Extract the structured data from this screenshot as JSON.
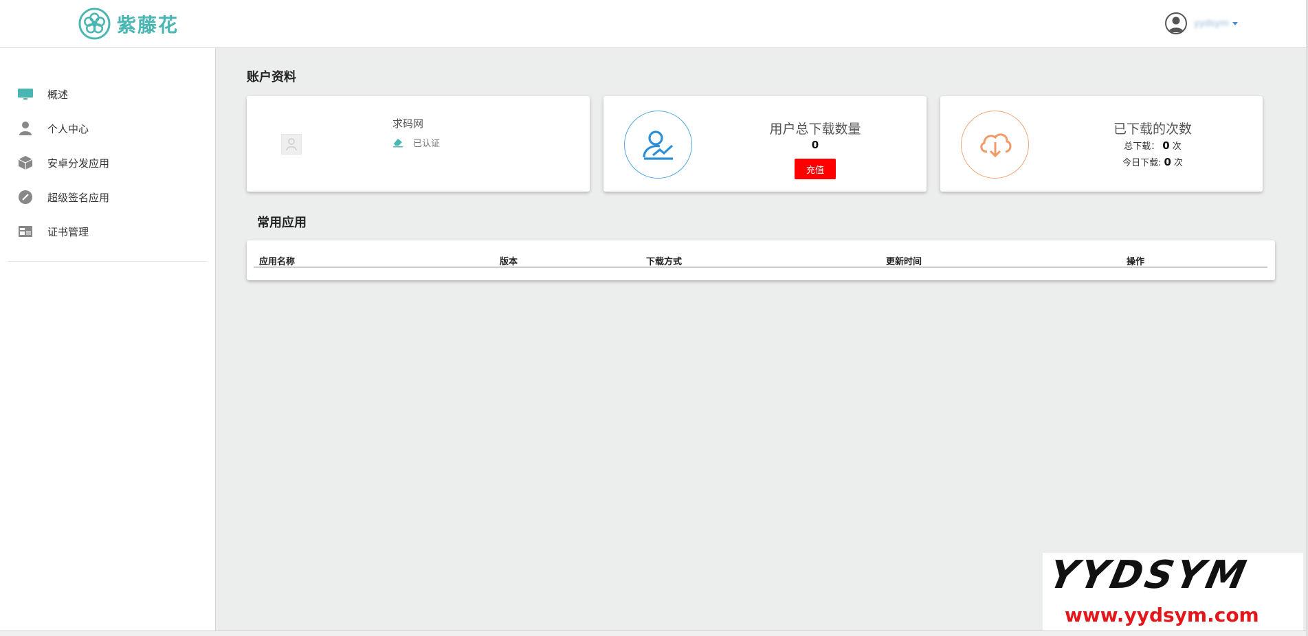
{
  "brand": {
    "name": "紫藤花",
    "color": "#49b6b3"
  },
  "header": {
    "user_name": "yydsym"
  },
  "sidebar": {
    "items": [
      {
        "label": "概述",
        "icon": "monitor-icon"
      },
      {
        "label": "个人中心",
        "icon": "user-icon"
      },
      {
        "label": "安卓分发应用",
        "icon": "package-icon"
      },
      {
        "label": "超级签名应用",
        "icon": "compass-icon"
      },
      {
        "label": "证书管理",
        "icon": "id-card-icon"
      }
    ]
  },
  "account": {
    "section_title": "账户资料",
    "site_name": "求码网",
    "verified_label": "已认证",
    "total_downloads_title": "用户总下载数量",
    "total_downloads_value": "0",
    "recharge_label": "充值",
    "downloaded_title": "已下载的次数",
    "total_label": "总下载：",
    "total_value": "0",
    "today_label": "今日下载:",
    "today_value": "0",
    "unit": "次"
  },
  "apps": {
    "section_title": "常用应用",
    "columns": [
      "应用名称",
      "版本",
      "下载方式",
      "更新时间",
      "操作"
    ]
  },
  "watermark": {
    "big": "YYDSYM",
    "url": "www.yydsym.com"
  },
  "colors": {
    "accent": "#49b6b3",
    "button": "#ff0000",
    "blue": "#2b8fd8",
    "orange": "#f2a77b"
  }
}
